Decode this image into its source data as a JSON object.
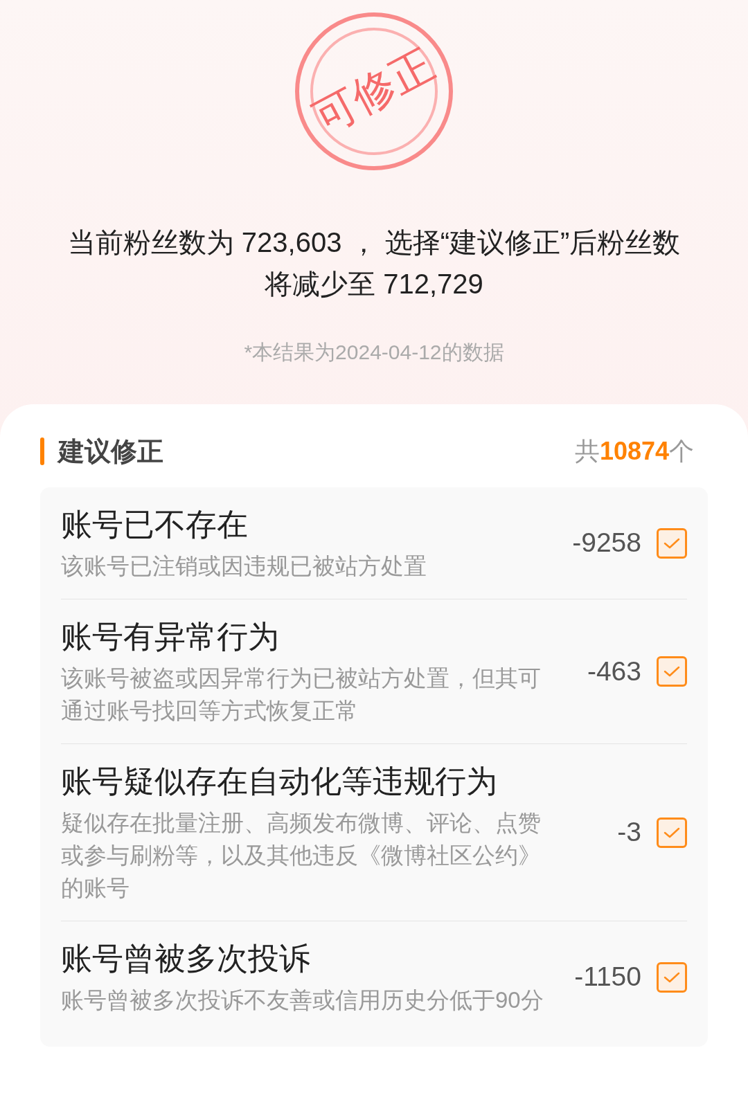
{
  "stamp": {
    "text": "可修正"
  },
  "summary": {
    "text": "当前粉丝数为 723,603 ， 选择“建议修正”后粉丝数将减少至 712,729",
    "note": "*本结果为2024-04-12的数据"
  },
  "section": {
    "title": "建议修正",
    "count_prefix": "共",
    "count": "10874",
    "count_suffix": "个"
  },
  "items": [
    {
      "title": "账号已不存在",
      "description": "该账号已注销或因违规已被站方处置",
      "delta": "-9258",
      "checked": true
    },
    {
      "title": "账号有异常行为",
      "description": "该账号被盗或因异常行为已被站方处置，但其可通过账号找回等方式恢复正常",
      "delta": "-463",
      "checked": true
    },
    {
      "title": "账号疑似存在自动化等违规行为",
      "description": "疑似存在批量注册、高频发布微博、评论、点赞或参与刷粉等，以及其他违反《微博社区公约》的账号",
      "delta": "-3",
      "checked": true
    },
    {
      "title": "账号曾被多次投诉",
      "description": "账号曾被多次投诉不友善或信用历史分低于90分",
      "delta": "-1150",
      "checked": true
    }
  ]
}
